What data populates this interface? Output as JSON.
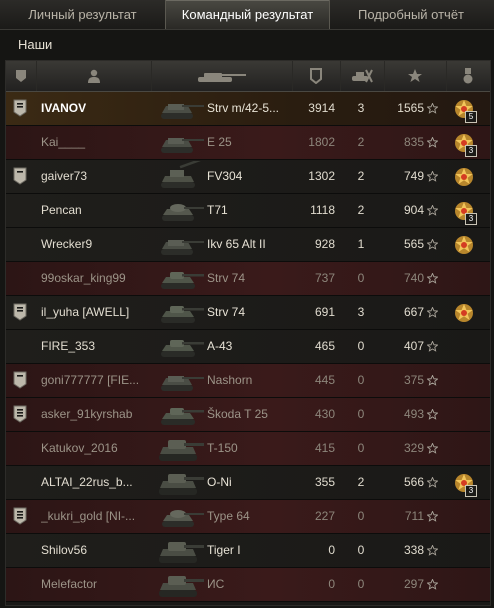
{
  "tabs": [
    {
      "label": "Личный результат"
    },
    {
      "label": "Командный результат"
    },
    {
      "label": "Подробный отчёт"
    }
  ],
  "team_label": "Наши",
  "colors": {
    "accent": "#e8b84a",
    "row_dead": "#3a1a1a",
    "row_alive": "#1f1e1b",
    "row_self": "#3b2a14"
  },
  "rows": [
    {
      "rank": "2",
      "player": "IVANOV",
      "tank": "Strv m/42-5...",
      "damage": "3914",
      "kills": "3",
      "xp": "1565",
      "medal": true,
      "medal_count": "5",
      "state": "me",
      "tank_type": "td"
    },
    {
      "rank": "",
      "player": "Kai____",
      "tank": "E 25",
      "damage": "1802",
      "kills": "2",
      "xp": "835",
      "medal": true,
      "medal_count": "3",
      "state": "red",
      "tank_type": "td"
    },
    {
      "rank": "1",
      "player": "gaiver73",
      "tank": "FV304",
      "damage": "1302",
      "kills": "2",
      "xp": "749",
      "medal": true,
      "medal_count": "",
      "state": "dark",
      "tank_type": "spg"
    },
    {
      "rank": "",
      "player": "Pencan",
      "tank": "T71",
      "damage": "1118",
      "kills": "2",
      "xp": "904",
      "medal": true,
      "medal_count": "3",
      "state": "dark",
      "tank_type": "lt"
    },
    {
      "rank": "",
      "player": "Wrecker9",
      "tank": "Ikv 65 Alt II",
      "damage": "928",
      "kills": "1",
      "xp": "565",
      "medal": true,
      "medal_count": "",
      "state": "dark",
      "tank_type": "td"
    },
    {
      "rank": "",
      "player": "99oskar_king99",
      "tank": "Strv 74",
      "damage": "737",
      "kills": "0",
      "xp": "740",
      "medal": false,
      "medal_count": "",
      "state": "red",
      "tank_type": "mt"
    },
    {
      "rank": "2",
      "player": "il_yuha [AWELL]",
      "tank": "Strv 74",
      "damage": "691",
      "kills": "3",
      "xp": "667",
      "medal": true,
      "medal_count": "",
      "state": "dark",
      "tank_type": "mt"
    },
    {
      "rank": "",
      "player": "FIRE_353",
      "tank": "A-43",
      "damage": "465",
      "kills": "0",
      "xp": "407",
      "medal": false,
      "medal_count": "",
      "state": "dark",
      "tank_type": "mt"
    },
    {
      "rank": "1",
      "player": "goni777777 [FIE...",
      "tank": "Nashorn",
      "damage": "445",
      "kills": "0",
      "xp": "375",
      "medal": false,
      "medal_count": "",
      "state": "red",
      "tank_type": "td"
    },
    {
      "rank": "3",
      "player": "asker_91kyrshab",
      "tank": "Škoda T 25",
      "damage": "430",
      "kills": "0",
      "xp": "493",
      "medal": false,
      "medal_count": "",
      "state": "red",
      "tank_type": "mt"
    },
    {
      "rank": "",
      "player": "Katukov_2016",
      "tank": "T-150",
      "damage": "415",
      "kills": "0",
      "xp": "329",
      "medal": false,
      "medal_count": "",
      "state": "red",
      "tank_type": "ht"
    },
    {
      "rank": "",
      "player": "ALTAI_22rus_b...",
      "tank": "O-Ni",
      "damage": "355",
      "kills": "2",
      "xp": "566",
      "medal": true,
      "medal_count": "3",
      "state": "dark",
      "tank_type": "ht"
    },
    {
      "rank": "3",
      "player": "_kukri_gold [NI-...",
      "tank": "Type 64",
      "damage": "227",
      "kills": "0",
      "xp": "711",
      "medal": false,
      "medal_count": "",
      "state": "red",
      "tank_type": "lt"
    },
    {
      "rank": "",
      "player": "Shilov56",
      "tank": "Tiger I",
      "damage": "0",
      "kills": "0",
      "xp": "338",
      "medal": false,
      "medal_count": "",
      "state": "dark",
      "tank_type": "ht"
    },
    {
      "rank": "",
      "player": "Melefactor",
      "tank": "ИС",
      "damage": "0",
      "kills": "0",
      "xp": "297",
      "medal": false,
      "medal_count": "",
      "state": "red",
      "tank_type": "ht"
    }
  ]
}
